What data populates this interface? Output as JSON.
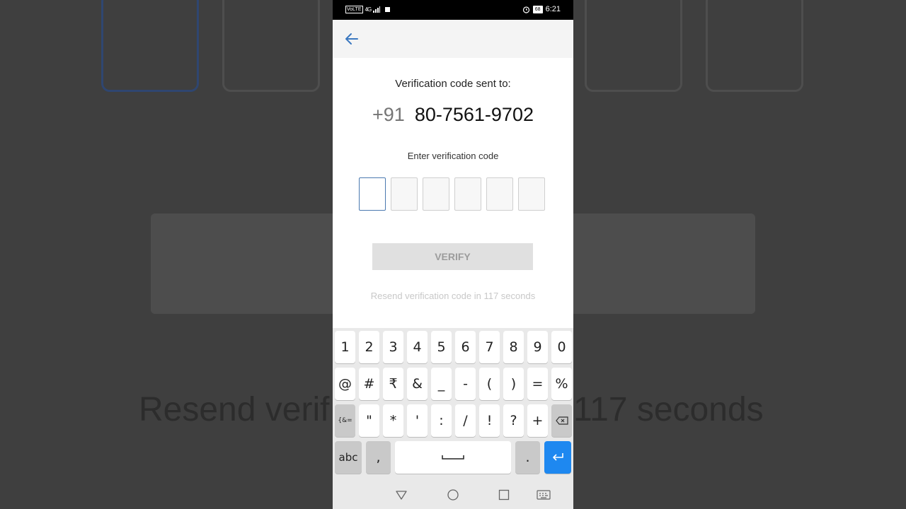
{
  "background": {
    "resend_left": "Resend verif",
    "resend_right": "117 seconds"
  },
  "status_bar": {
    "volte": "VoLTE",
    "network": "4G",
    "battery": "68",
    "time": "6:21"
  },
  "screen": {
    "sent_label": "Verification code sent to:",
    "country_code": "+91",
    "phone_number": "80-7561-9702",
    "enter_label": "Enter verification code",
    "otp_digits": [
      "",
      "",
      "",
      "",
      "",
      ""
    ],
    "verify_label": "VERIFY",
    "resend_text": "Resend verification code in 117 seconds"
  },
  "keyboard": {
    "row1": [
      "1",
      "2",
      "3",
      "4",
      "5",
      "6",
      "7",
      "8",
      "9",
      "0"
    ],
    "row2": [
      "@",
      "#",
      "₹",
      "&",
      "_",
      "-",
      "(",
      ")",
      "=",
      "%"
    ],
    "row3_symbols_key": "{&=",
    "row3": [
      "\"",
      "*",
      "'",
      ":",
      "/",
      "!",
      "?",
      "+"
    ],
    "abc_key": "abc",
    "comma_key": ",",
    "period_key": "."
  },
  "colors": {
    "accent": "#1e88f0",
    "otp_active_border": "#4a79b0",
    "back_arrow": "#3b78c0"
  }
}
